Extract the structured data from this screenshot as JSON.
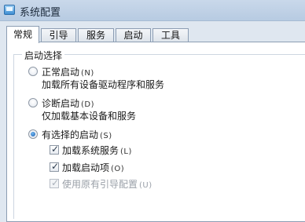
{
  "window": {
    "title": "系统配置"
  },
  "tabs": [
    {
      "label": "常规",
      "active": true
    },
    {
      "label": "引导",
      "active": false
    },
    {
      "label": "服务",
      "active": false
    },
    {
      "label": "启动",
      "active": false
    },
    {
      "label": "工具",
      "active": false
    }
  ],
  "startup_selection": {
    "group_title": "启动选择",
    "normal": {
      "label": "正常启动",
      "mnemonic": "(N)",
      "description": "加载所有设备驱动程序和服务",
      "checked": false
    },
    "diagnostic": {
      "label": "诊断启动",
      "mnemonic": "(D)",
      "description": "仅加载基本设备和服务",
      "checked": false
    },
    "selective": {
      "label": "有选择的启动",
      "mnemonic": "(S)",
      "checked": true,
      "options": [
        {
          "label": "加载系统服务",
          "mnemonic": "(L)",
          "checked": true,
          "enabled": true
        },
        {
          "label": "加载启动项",
          "mnemonic": "(O)",
          "checked": true,
          "enabled": true
        },
        {
          "label": "使用原有引导配置",
          "mnemonic": "(U)",
          "checked": true,
          "enabled": false
        }
      ]
    }
  }
}
